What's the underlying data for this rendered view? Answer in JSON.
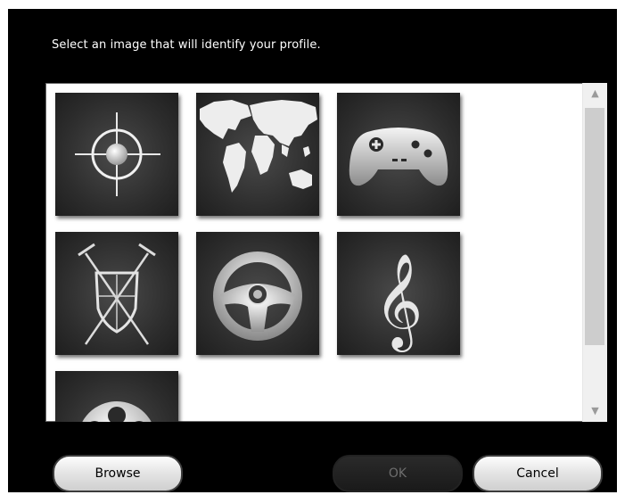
{
  "dialog": {
    "prompt": "Select an image that will identify your profile."
  },
  "gallery": {
    "items": [
      {
        "name": "crosshair",
        "icon": "crosshair-icon"
      },
      {
        "name": "world map",
        "icon": "world-map-icon"
      },
      {
        "name": "gamepad",
        "icon": "gamepad-icon"
      },
      {
        "name": "shield with swords",
        "icon": "shield-swords-icon"
      },
      {
        "name": "steering wheel",
        "icon": "steering-wheel-icon"
      },
      {
        "name": "treble clef",
        "icon": "treble-clef-icon"
      },
      {
        "name": "film reel",
        "icon": "film-reel-icon"
      }
    ]
  },
  "buttons": {
    "browse": "Browse",
    "ok": "OK",
    "cancel": "Cancel"
  },
  "colors": {
    "dialog_background": "#000000",
    "tile_background": "#2c2c2c",
    "panel_background": "#ffffff"
  }
}
